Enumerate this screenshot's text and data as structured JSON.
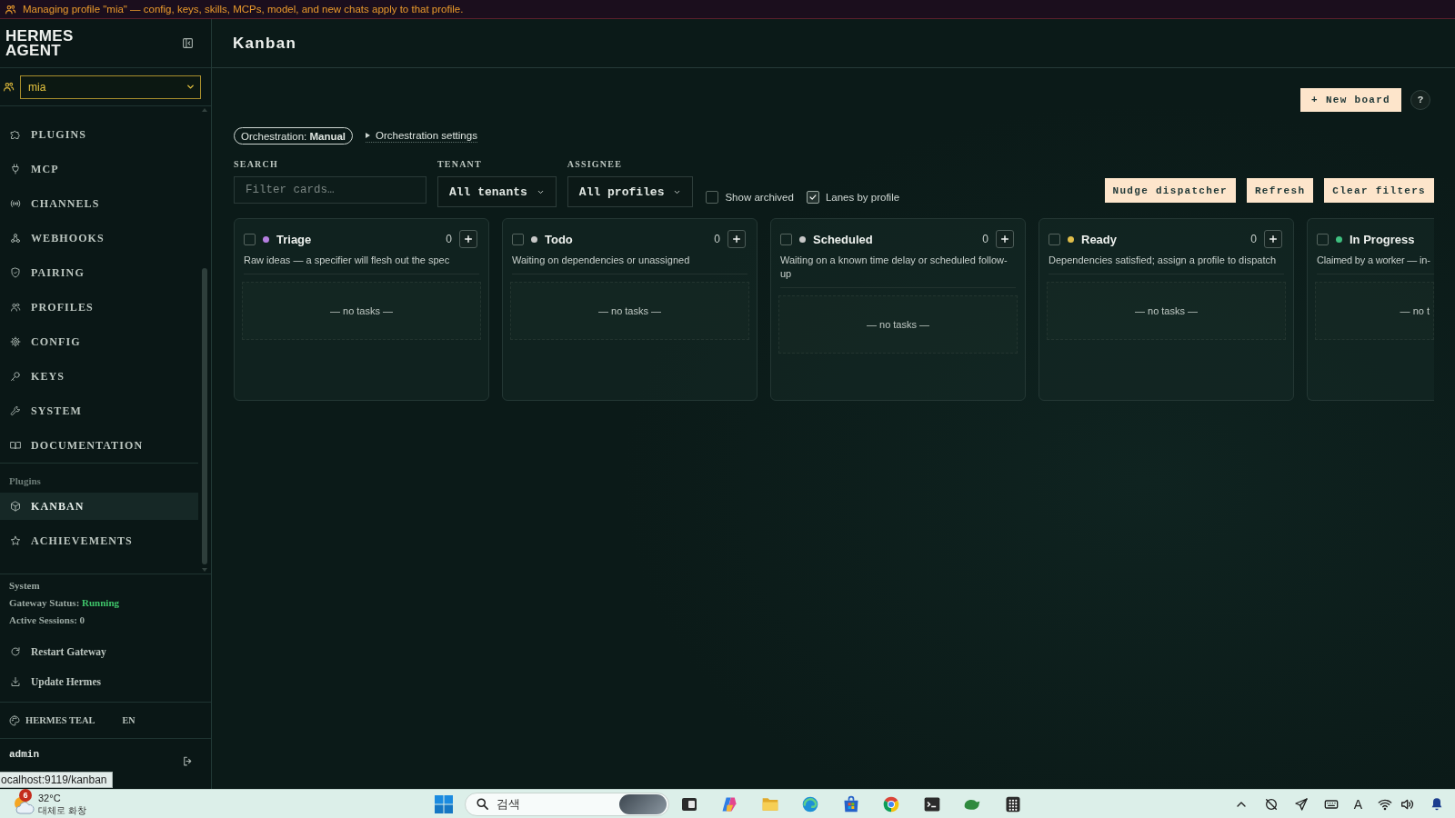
{
  "banner": {
    "text": "Managing profile \"mia\" — config, keys, skills, MCPs, model, and new chats apply to that profile."
  },
  "sidebar": {
    "brand": "HERMES AGENT",
    "profile": {
      "value": "mia"
    },
    "nav": [
      {
        "label": "PLUGINS",
        "selected": false
      },
      {
        "label": "MCP",
        "selected": false
      },
      {
        "label": "CHANNELS",
        "selected": false
      },
      {
        "label": "WEBHOOKS",
        "selected": false
      },
      {
        "label": "PAIRING",
        "selected": false
      },
      {
        "label": "PROFILES",
        "selected": false
      },
      {
        "label": "CONFIG",
        "selected": false
      },
      {
        "label": "KEYS",
        "selected": false
      },
      {
        "label": "SYSTEM",
        "selected": false
      },
      {
        "label": "DOCUMENTATION",
        "selected": false
      }
    ],
    "plugins": {
      "heading": "Plugins",
      "items": [
        {
          "label": "KANBAN",
          "selected": true
        },
        {
          "label": "ACHIEVEMENTS",
          "selected": false
        }
      ]
    },
    "system": {
      "heading": "System",
      "gateway_label": "Gateway Status:",
      "gateway_status": "Running",
      "sessions": "Active Sessions: 0"
    },
    "actions": [
      "Restart Gateway",
      "Update Hermes"
    ],
    "theme": {
      "label": "HERMES TEAL",
      "language": "EN"
    },
    "user": {
      "name": "admin"
    }
  },
  "status_url": "ocalhost:9119/kanban",
  "main": {
    "title": "Kanban",
    "new_board": "+ New board",
    "help": "?",
    "orchestration": "Orchestration: **Manual**",
    "orchestration_settings": {
      "label": "Orchestration settings",
      "expanded": false
    },
    "filters": {
      "search": {
        "label": "SEARCH",
        "placeholder": "Filter cards…"
      },
      "tenant": {
        "label": "TENANT",
        "value": "All tenants"
      },
      "assignee": {
        "label": "ASSIGNEE",
        "value": "All profiles"
      }
    },
    "toggles": [
      {
        "label": "Show archived",
        "checked": false
      },
      {
        "label": "Lanes by profile",
        "checked": true
      }
    ],
    "actions": [
      "Nudge dispatcher",
      "Refresh",
      "Clear filters"
    ],
    "columns": [
      {
        "title": "Triage",
        "color": "#b57fe0",
        "count": "0",
        "checked": false,
        "description": "Raw ideas — a specifier will flesh out the spec",
        "empty": "— no tasks —"
      },
      {
        "title": "Todo",
        "color": "#c8c8c8",
        "count": "0",
        "checked": false,
        "description": "Waiting on dependencies or unassigned",
        "empty": "— no tasks —"
      },
      {
        "title": "Scheduled",
        "color": "#c8c8c8",
        "count": "0",
        "checked": false,
        "description": "Waiting on a known time delay or scheduled follow-up",
        "empty": "— no tasks —"
      },
      {
        "title": "Ready",
        "color": "#e0bd4a",
        "count": "0",
        "checked": false,
        "description": "Dependencies satisfied; assign a profile to dispatch",
        "empty": "— no tasks —"
      },
      {
        "title": "In Progress",
        "color": "#3fbf7f",
        "checked": false,
        "description": "Claimed by a worker — in-",
        "empty": "— no t"
      }
    ]
  },
  "taskbar": {
    "weather": {
      "badge": "6",
      "temperature": "32°C",
      "condition": "대체로 화창"
    },
    "search": {
      "label": "검색"
    },
    "input_indicator": "A"
  }
}
